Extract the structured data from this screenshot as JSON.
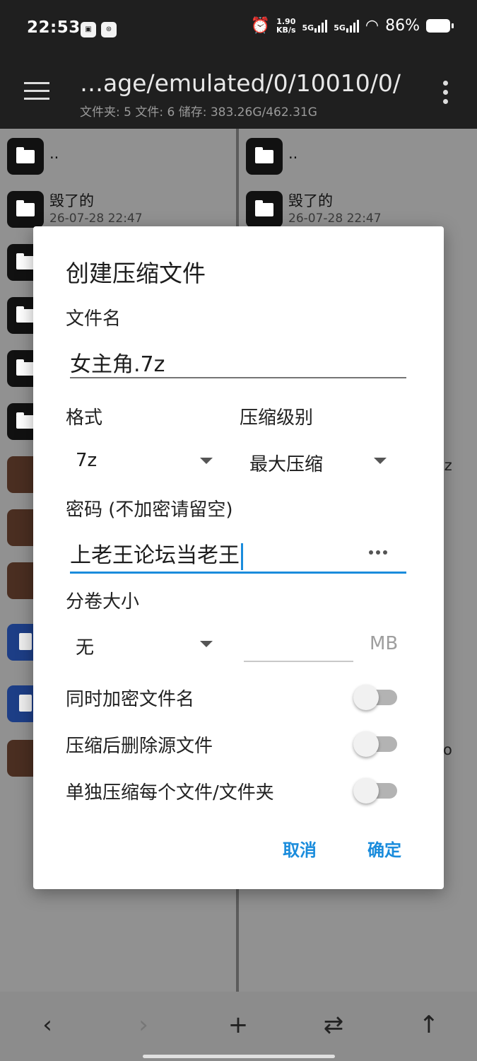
{
  "status_bar": {
    "time": "22:53",
    "speed_value": "1.90",
    "speed_unit": "KB/s",
    "sim1": "5G",
    "sim2": "5G",
    "battery": "86%",
    "icons": [
      "alarm-icon",
      "wifi-icon",
      "battery-icon",
      "signal-icon"
    ]
  },
  "app_bar": {
    "path": "…age/emulated/0/10010/0/",
    "summary": "文件夹: 5  文件: 6  储存: 383.26G/462.31G"
  },
  "left_pane": {
    "items": [
      {
        "name": "..",
        "date": "",
        "kind": "folder"
      },
      {
        "name": "毁了的",
        "date": "26-07-28 22:47",
        "kind": "folder"
      },
      {
        "name": "",
        "date": "",
        "kind": "folder"
      },
      {
        "name": "",
        "date": "",
        "kind": "folder"
      },
      {
        "name": "",
        "date": "",
        "kind": "folder"
      },
      {
        "name": "",
        "date": "",
        "kind": "folder"
      },
      {
        "name": "",
        "date": "",
        "kind": "archive"
      },
      {
        "name": "",
        "date": "",
        "kind": "archive"
      },
      {
        "name": "",
        "date": "",
        "kind": "archive"
      },
      {
        "name": "",
        "date": "",
        "kind": "document"
      },
      {
        "name": "",
        "date": "",
        "kind": "document"
      },
      {
        "name": "",
        "date": "",
        "kind": "archive"
      }
    ]
  },
  "right_pane": {
    "items": [
      {
        "name": "..",
        "date": "",
        "kind": "folder"
      },
      {
        "name": "毁了的",
        "date": "26-07-28 22:47",
        "kind": "folder"
      }
    ],
    "stray_texts": [
      "'z",
      "o"
    ]
  },
  "dialog": {
    "title": "创建压缩文件",
    "filename_label": "文件名",
    "filename_value": "女主角.7z",
    "format_label": "格式",
    "format_value": "7z",
    "level_label": "压缩级别",
    "level_value": "最大压缩",
    "password_label": "密码 (不加密请留空)",
    "password_value": "上老王论坛当老王",
    "split_label": "分卷大小",
    "split_value": "无",
    "split_size_value": "",
    "split_unit": "MB",
    "options": [
      {
        "label": "同时加密文件名",
        "on": false
      },
      {
        "label": "压缩后删除源文件",
        "on": false
      },
      {
        "label": "单独压缩每个文件/文件夹",
        "on": false
      }
    ],
    "cancel": "取消",
    "confirm": "确定"
  },
  "bottom_bar": {
    "buttons": [
      "‹",
      "›",
      "+",
      "⇄",
      "↑"
    ]
  },
  "colors": {
    "accent": "#1a8cdc",
    "app_bar": "#1f1f1f",
    "dim_overlay": "#8a8a8a"
  }
}
